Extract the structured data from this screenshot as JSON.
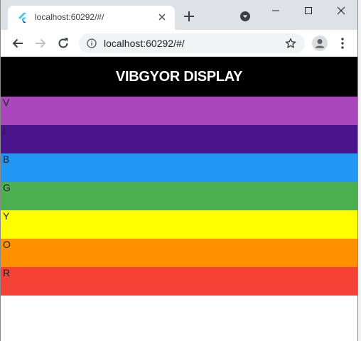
{
  "browser": {
    "tab_title": "localhost:60292/#/",
    "url": "localhost:60292/#/"
  },
  "app": {
    "title": "VIBGYOR DISPLAY"
  },
  "bands": [
    {
      "label": "V",
      "color": "#ab47bc"
    },
    {
      "label": "I",
      "color": "#4a148c"
    },
    {
      "label": "B",
      "color": "#2196f3"
    },
    {
      "label": "G",
      "color": "#4caf50"
    },
    {
      "label": "Y",
      "color": "#ffff00"
    },
    {
      "label": "O",
      "color": "#ff9100"
    },
    {
      "label": "R",
      "color": "#f44336"
    }
  ],
  "colors": {
    "appbar": "#000000",
    "tabstrip": "#dee1e6",
    "omnibox": "#f1f3f4"
  }
}
